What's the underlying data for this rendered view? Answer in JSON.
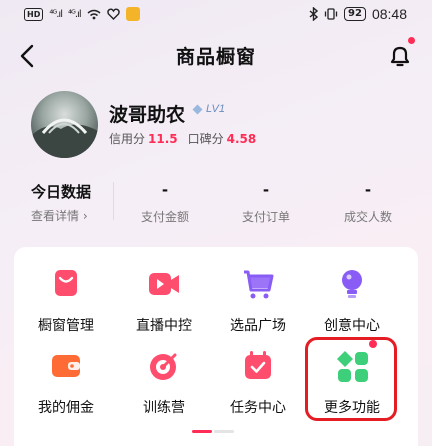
{
  "status_bar": {
    "network_badge": "HD",
    "signal_1": "⁴ᴳ.ıl",
    "signal_2": "⁴ᴳ.ıl",
    "battery": "92",
    "time": "08:48"
  },
  "nav": {
    "title": "商品橱窗"
  },
  "profile": {
    "name": "波哥助农",
    "level": "LV1",
    "credit_label": "信用分",
    "credit_value": "11.5",
    "reputation_label": "口碑分",
    "reputation_value": "4.58"
  },
  "stats": {
    "today_label": "今日数据",
    "details_link": "查看详情 ›",
    "items": [
      {
        "value": "-",
        "label": "支付金额"
      },
      {
        "value": "-",
        "label": "支付订单"
      },
      {
        "value": "-",
        "label": "成交人数"
      }
    ]
  },
  "tools": [
    {
      "label": "橱窗管理",
      "icon": "shopping-bag-icon",
      "color": "#ff4d6d"
    },
    {
      "label": "直播中控",
      "icon": "video-camera-icon",
      "color": "#ff4d6d"
    },
    {
      "label": "选品广场",
      "icon": "shopping-cart-icon",
      "color": "#8a5cf6"
    },
    {
      "label": "创意中心",
      "icon": "light-bulb-icon",
      "color": "#8a5cf6"
    },
    {
      "label": "我的佣金",
      "icon": "wallet-icon",
      "color": "#ff6b35"
    },
    {
      "label": "训练营",
      "icon": "target-icon",
      "color": "#ff4d6d"
    },
    {
      "label": "任务中心",
      "icon": "calendar-check-icon",
      "color": "#ff4d6d"
    },
    {
      "label": "更多功能",
      "icon": "app-grid-icon",
      "color": "#3ecf7a"
    }
  ],
  "colors": {
    "accent": "#ff2d55",
    "highlight_box": "#e51c24"
  }
}
